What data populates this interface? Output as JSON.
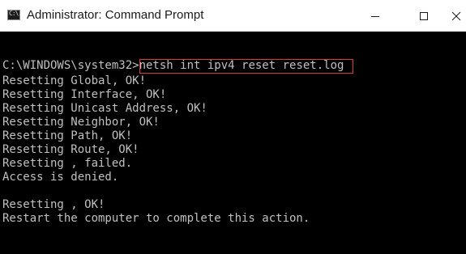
{
  "window": {
    "title": "Administrator: Command Prompt",
    "app_icon": "cmd-icon",
    "app_icon_glyph": "C:\\.",
    "controls": {
      "minimize": "minimize-icon",
      "maximize": "maximize-icon",
      "close": "close-icon"
    }
  },
  "console": {
    "prompt": "C:\\WINDOWS\\system32>",
    "command": "netsh int ipv4 reset reset.log",
    "output": [
      "Resetting Global, OK!",
      "Resetting Interface, OK!",
      "Resetting Unicast Address, OK!",
      "Resetting Neighbor, OK!",
      "Resetting Path, OK!",
      "Resetting Route, OK!",
      "Resetting , failed.",
      "Access is denied.",
      "",
      "Resetting , OK!",
      "Restart the computer to complete this action."
    ],
    "highlight_color": "#d63a3a",
    "text_color": "#c0c0c0",
    "background_color": "#000000"
  }
}
